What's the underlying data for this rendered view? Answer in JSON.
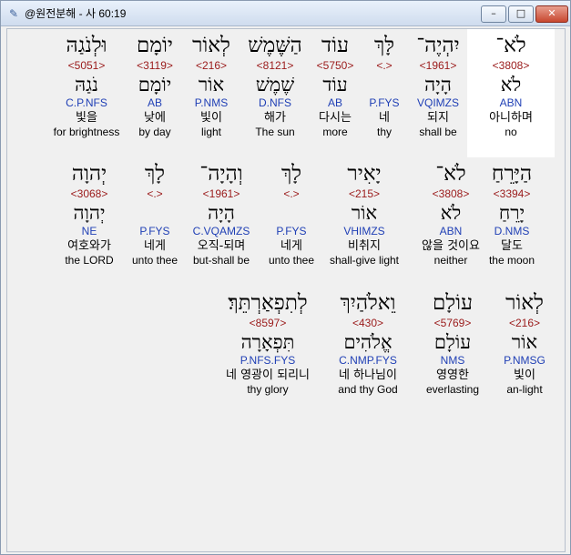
{
  "window": {
    "title": "@원전분해 - 사 60:19",
    "minimize_label": "–",
    "maximize_label": "□",
    "close_label": "✕"
  },
  "colors": {
    "strong": "#9a1a1a",
    "parse": "#1f3fb5",
    "highlight": "#ffffff"
  },
  "rows": [
    [
      {
        "heb": "לֹא־",
        "strong": "<3808>",
        "lemma": "לֹא",
        "parse": "ABN",
        "korean": "아니하며",
        "english": "no",
        "highlight": true
      },
      {
        "heb": "יִהְיֶה־",
        "strong": "<1961>",
        "lemma": "הָיָה",
        "parse": "VQIMZS",
        "korean": "되지",
        "english": "shall be"
      },
      {
        "heb": "לָּךְ",
        "strong": "<.>",
        "lemma": "",
        "parse": "P.FYS",
        "korean": "네",
        "english": "thy"
      },
      {
        "heb": "עוֹד",
        "strong": "<5750>",
        "lemma": "עוֹד",
        "parse": "AB",
        "korean": "다시는",
        "english": "more"
      },
      {
        "heb": "הַשֶּׁמֶשׁ",
        "strong": "<8121>",
        "lemma": "שֶׁמֶשׁ",
        "parse": "D.NFS",
        "korean": "해가",
        "english": "The sun"
      },
      {
        "heb": "לְאוֹר",
        "strong": "<216>",
        "lemma": "אוֹר",
        "parse": "P.NMS",
        "korean": "빛이",
        "english": "light"
      },
      {
        "heb": "יוֹמָם",
        "strong": "<3119>",
        "lemma": "יוֹמָם",
        "parse": "AB",
        "korean": "낮에",
        "english": "by day"
      },
      {
        "heb": "וּלְנֹגַהּ",
        "strong": "<5051>",
        "lemma": "נֹגַהּ",
        "parse": "C.P.NFS",
        "korean": "빛을",
        "english": "for brightness"
      }
    ],
    [
      {
        "heb": "הַיָּרֵחַ",
        "strong": "<3394>",
        "lemma": "יָרֵחַ",
        "parse": "D.NMS",
        "korean": "달도",
        "english": "the moon"
      },
      {
        "heb": "לֹא־",
        "strong": "<3808>",
        "lemma": "לֹא",
        "parse": "ABN",
        "korean": "않을 것이요",
        "english": "neither"
      },
      {
        "heb": "יָאִיר",
        "strong": "<215>",
        "lemma": "אוֹר",
        "parse": "VHIMZS",
        "korean": "비취지",
        "english": "shall-give light"
      },
      {
        "heb": "לָךְ",
        "strong": "<.>",
        "lemma": "",
        "parse": "P.FYS",
        "korean": "네게",
        "english": "unto thee"
      },
      {
        "heb": "וְהָיָה־",
        "strong": "<1961>",
        "lemma": "הָיָה",
        "parse": "C.VQAMZS",
        "korean": "오직-되며",
        "english": "but-shall be"
      },
      {
        "heb": "לָךְ",
        "strong": "<.>",
        "lemma": "",
        "parse": "P.FYS",
        "korean": "네게",
        "english": "unto thee"
      },
      {
        "heb": "יְהוָה",
        "strong": "<3068>",
        "lemma": "יְהוָה",
        "parse": "NE",
        "korean": "여호와가",
        "english": "the LORD"
      }
    ],
    [
      {
        "heb": "לְאוֹר",
        "strong": "<216>",
        "lemma": "אוֹר",
        "parse": "P.NMSG",
        "korean": "빛이",
        "english": "an-light"
      },
      {
        "heb": "עוֹלָם",
        "strong": "<5769>",
        "lemma": "עוֹלָם",
        "parse": "NMS",
        "korean": "영영한",
        "english": "everlasting"
      },
      {
        "heb": "וֵאלֹהַיִךְ",
        "strong": "<430>",
        "lemma": "אֱלֹהִים",
        "parse": "C.NMP.FYS",
        "korean": "네 하나님이",
        "english": "and thy God"
      },
      {
        "heb": "לְתִפְאַרְתֵּךְ׃",
        "strong": "<8597>",
        "lemma": "תִּפְאָרָה",
        "parse": "P.NFS.FYS",
        "korean": "네 영광이 되리니",
        "english": "thy glory"
      }
    ]
  ]
}
